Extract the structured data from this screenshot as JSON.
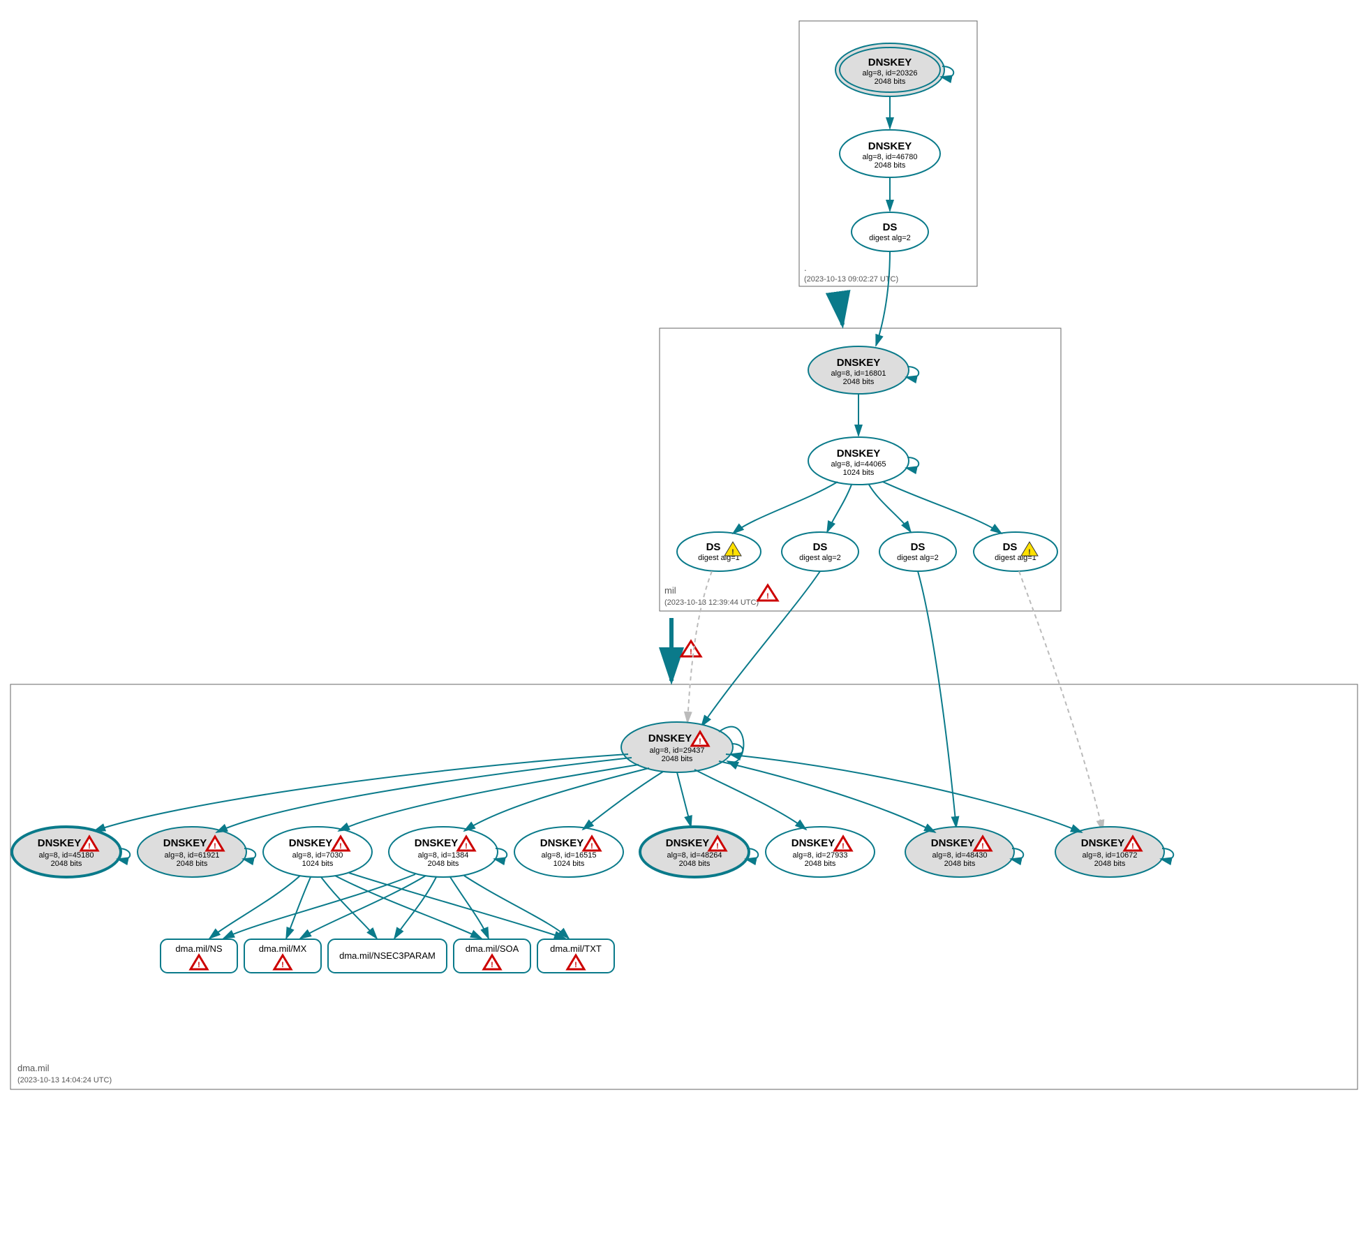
{
  "zones": {
    "root": {
      "label": ".",
      "time": "(2023-10-13 09:02:27 UTC)"
    },
    "mil": {
      "label": "mil",
      "time": "(2023-10-13 12:39:44 UTC)"
    },
    "dma": {
      "label": "dma.mil",
      "time": "(2023-10-13 14:04:24 UTC)"
    }
  },
  "nodes": {
    "root_ksk": {
      "t": "DNSKEY",
      "s": "alg=8, id=20326",
      "b": "2048 bits"
    },
    "root_zsk": {
      "t": "DNSKEY",
      "s": "alg=8, id=46780",
      "b": "2048 bits"
    },
    "root_ds": {
      "t": "DS",
      "s": "digest alg=2"
    },
    "mil_ksk": {
      "t": "DNSKEY",
      "s": "alg=8, id=16801",
      "b": "2048 bits"
    },
    "mil_zsk": {
      "t": "DNSKEY",
      "s": "alg=8, id=44065",
      "b": "1024 bits"
    },
    "ds1": {
      "t": "DS",
      "s": "digest alg=1"
    },
    "ds2": {
      "t": "DS",
      "s": "digest alg=2"
    },
    "ds3": {
      "t": "DS",
      "s": "digest alg=2"
    },
    "ds4": {
      "t": "DS",
      "s": "digest alg=1"
    },
    "dma_ksk": {
      "t": "DNSKEY",
      "s": "alg=8, id=29437",
      "b": "2048 bits"
    },
    "k45180": {
      "t": "DNSKEY",
      "s": "alg=8, id=45180",
      "b": "2048 bits"
    },
    "k61921": {
      "t": "DNSKEY",
      "s": "alg=8, id=61921",
      "b": "2048 bits"
    },
    "k7030": {
      "t": "DNSKEY",
      "s": "alg=8, id=7030",
      "b": "1024 bits"
    },
    "k1384": {
      "t": "DNSKEY",
      "s": "alg=8, id=1384",
      "b": "2048 bits"
    },
    "k16515": {
      "t": "DNSKEY",
      "s": "alg=8, id=16515",
      "b": "1024 bits"
    },
    "k48264": {
      "t": "DNSKEY",
      "s": "alg=8, id=48264",
      "b": "2048 bits"
    },
    "k27933": {
      "t": "DNSKEY",
      "s": "alg=8, id=27933",
      "b": "2048 bits"
    },
    "k48430": {
      "t": "DNSKEY",
      "s": "alg=8, id=48430",
      "b": "2048 bits"
    },
    "k10672": {
      "t": "DNSKEY",
      "s": "alg=8, id=10672",
      "b": "2048 bits"
    }
  },
  "rr": {
    "ns": "dma.mil/NS",
    "mx": "dma.mil/MX",
    "nsec3": "dma.mil/NSEC3PARAM",
    "soa": "dma.mil/SOA",
    "txt": "dma.mil/TXT"
  }
}
